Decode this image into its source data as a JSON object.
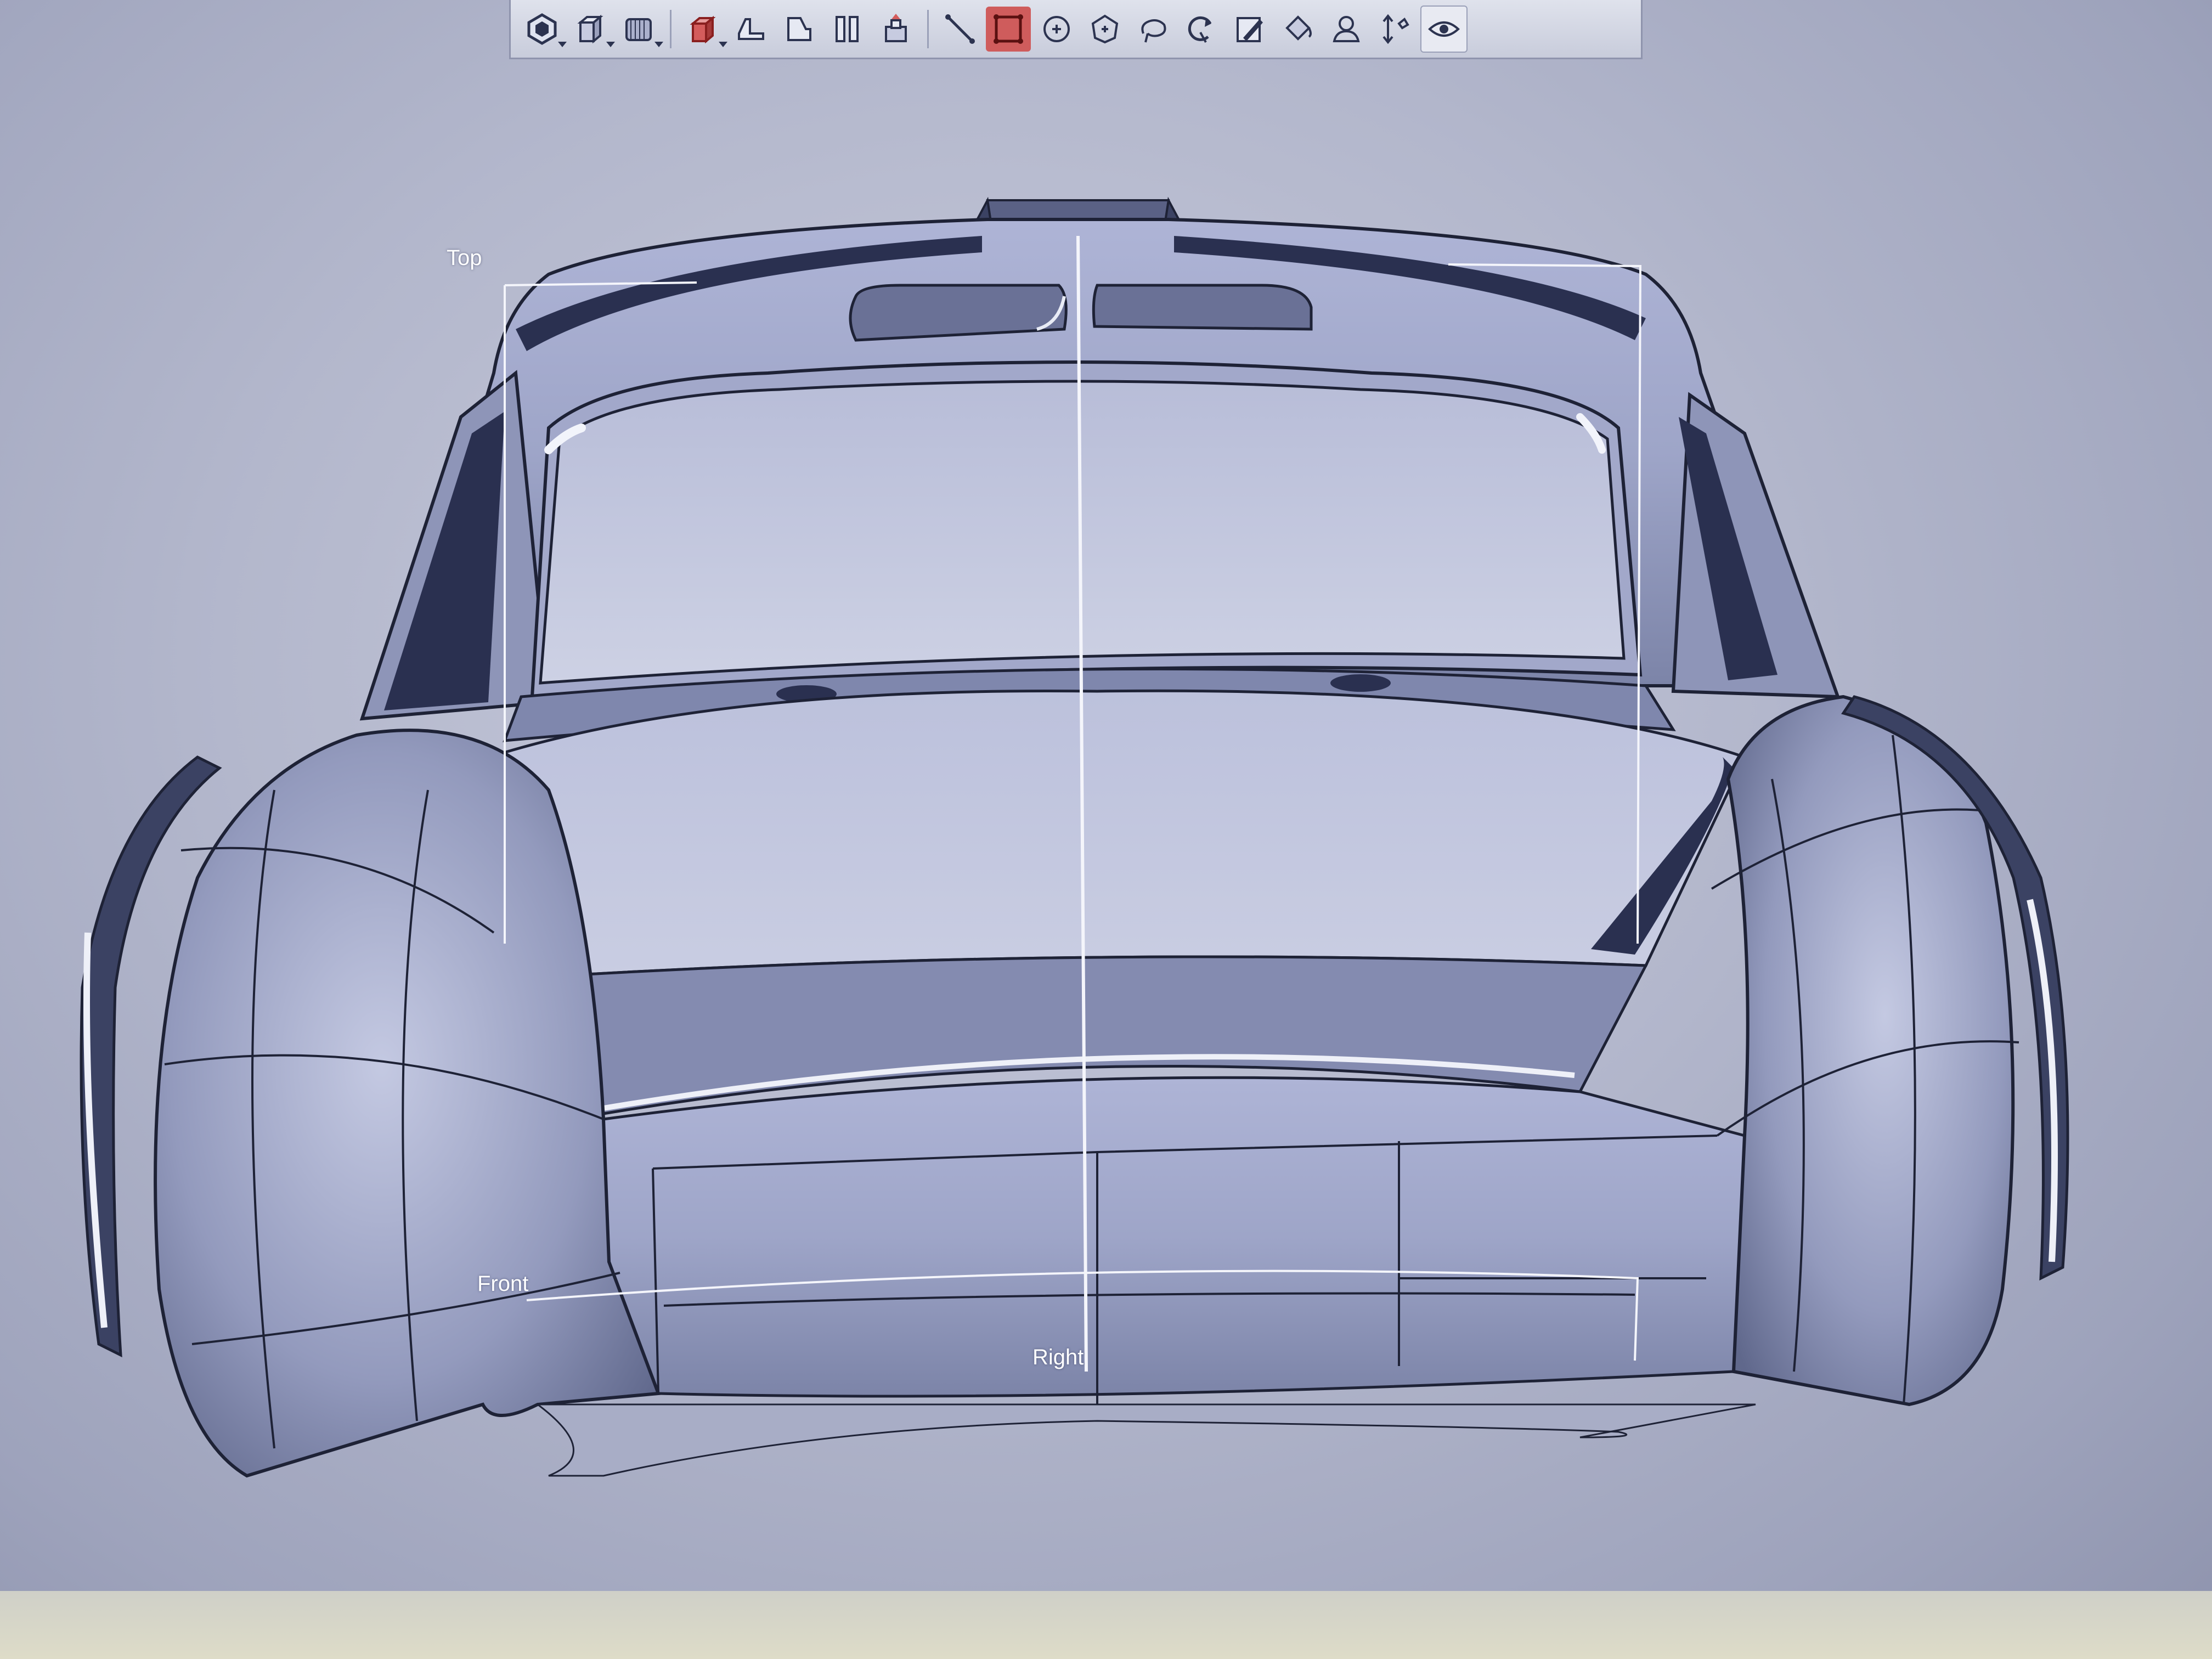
{
  "viewport": {
    "labels": {
      "top": "Top",
      "front": "Front",
      "right": "Right"
    },
    "colors": {
      "background": "#b3b7cc",
      "surface": "#9aa1c4",
      "edge": "#1e2236",
      "highlight": "#eef0f8",
      "toolbar_active": "#cf5c5c"
    }
  },
  "toolbar": {
    "buttons": [
      {
        "name": "object-mode-icon",
        "has_dropdown": true
      },
      {
        "name": "box-primitive-icon",
        "has_dropdown": true
      },
      {
        "name": "surface-primitive-icon",
        "has_dropdown": true
      },
      {
        "name": "shaded-cube-icon",
        "has_dropdown": true
      },
      {
        "name": "top-view-icon",
        "has_dropdown": false
      },
      {
        "name": "front-view-icon",
        "has_dropdown": false
      },
      {
        "name": "side-view-icon",
        "has_dropdown": false
      },
      {
        "name": "perspective-view-icon",
        "has_dropdown": false
      },
      {
        "name": "line-tool-icon",
        "has_dropdown": false
      },
      {
        "name": "box-select-icon",
        "has_dropdown": false,
        "active": true
      },
      {
        "name": "circle-select-icon",
        "has_dropdown": false
      },
      {
        "name": "polygon-select-icon",
        "has_dropdown": false
      },
      {
        "name": "lasso-select-icon",
        "has_dropdown": false
      },
      {
        "name": "rotate-tool-icon",
        "has_dropdown": false
      },
      {
        "name": "edit-tool-icon",
        "has_dropdown": false
      },
      {
        "name": "paint-bucket-icon",
        "has_dropdown": false
      },
      {
        "name": "user-view-icon",
        "has_dropdown": false
      },
      {
        "name": "transform-axis-icon",
        "has_dropdown": false
      },
      {
        "name": "visibility-icon",
        "has_dropdown": false
      }
    ]
  }
}
